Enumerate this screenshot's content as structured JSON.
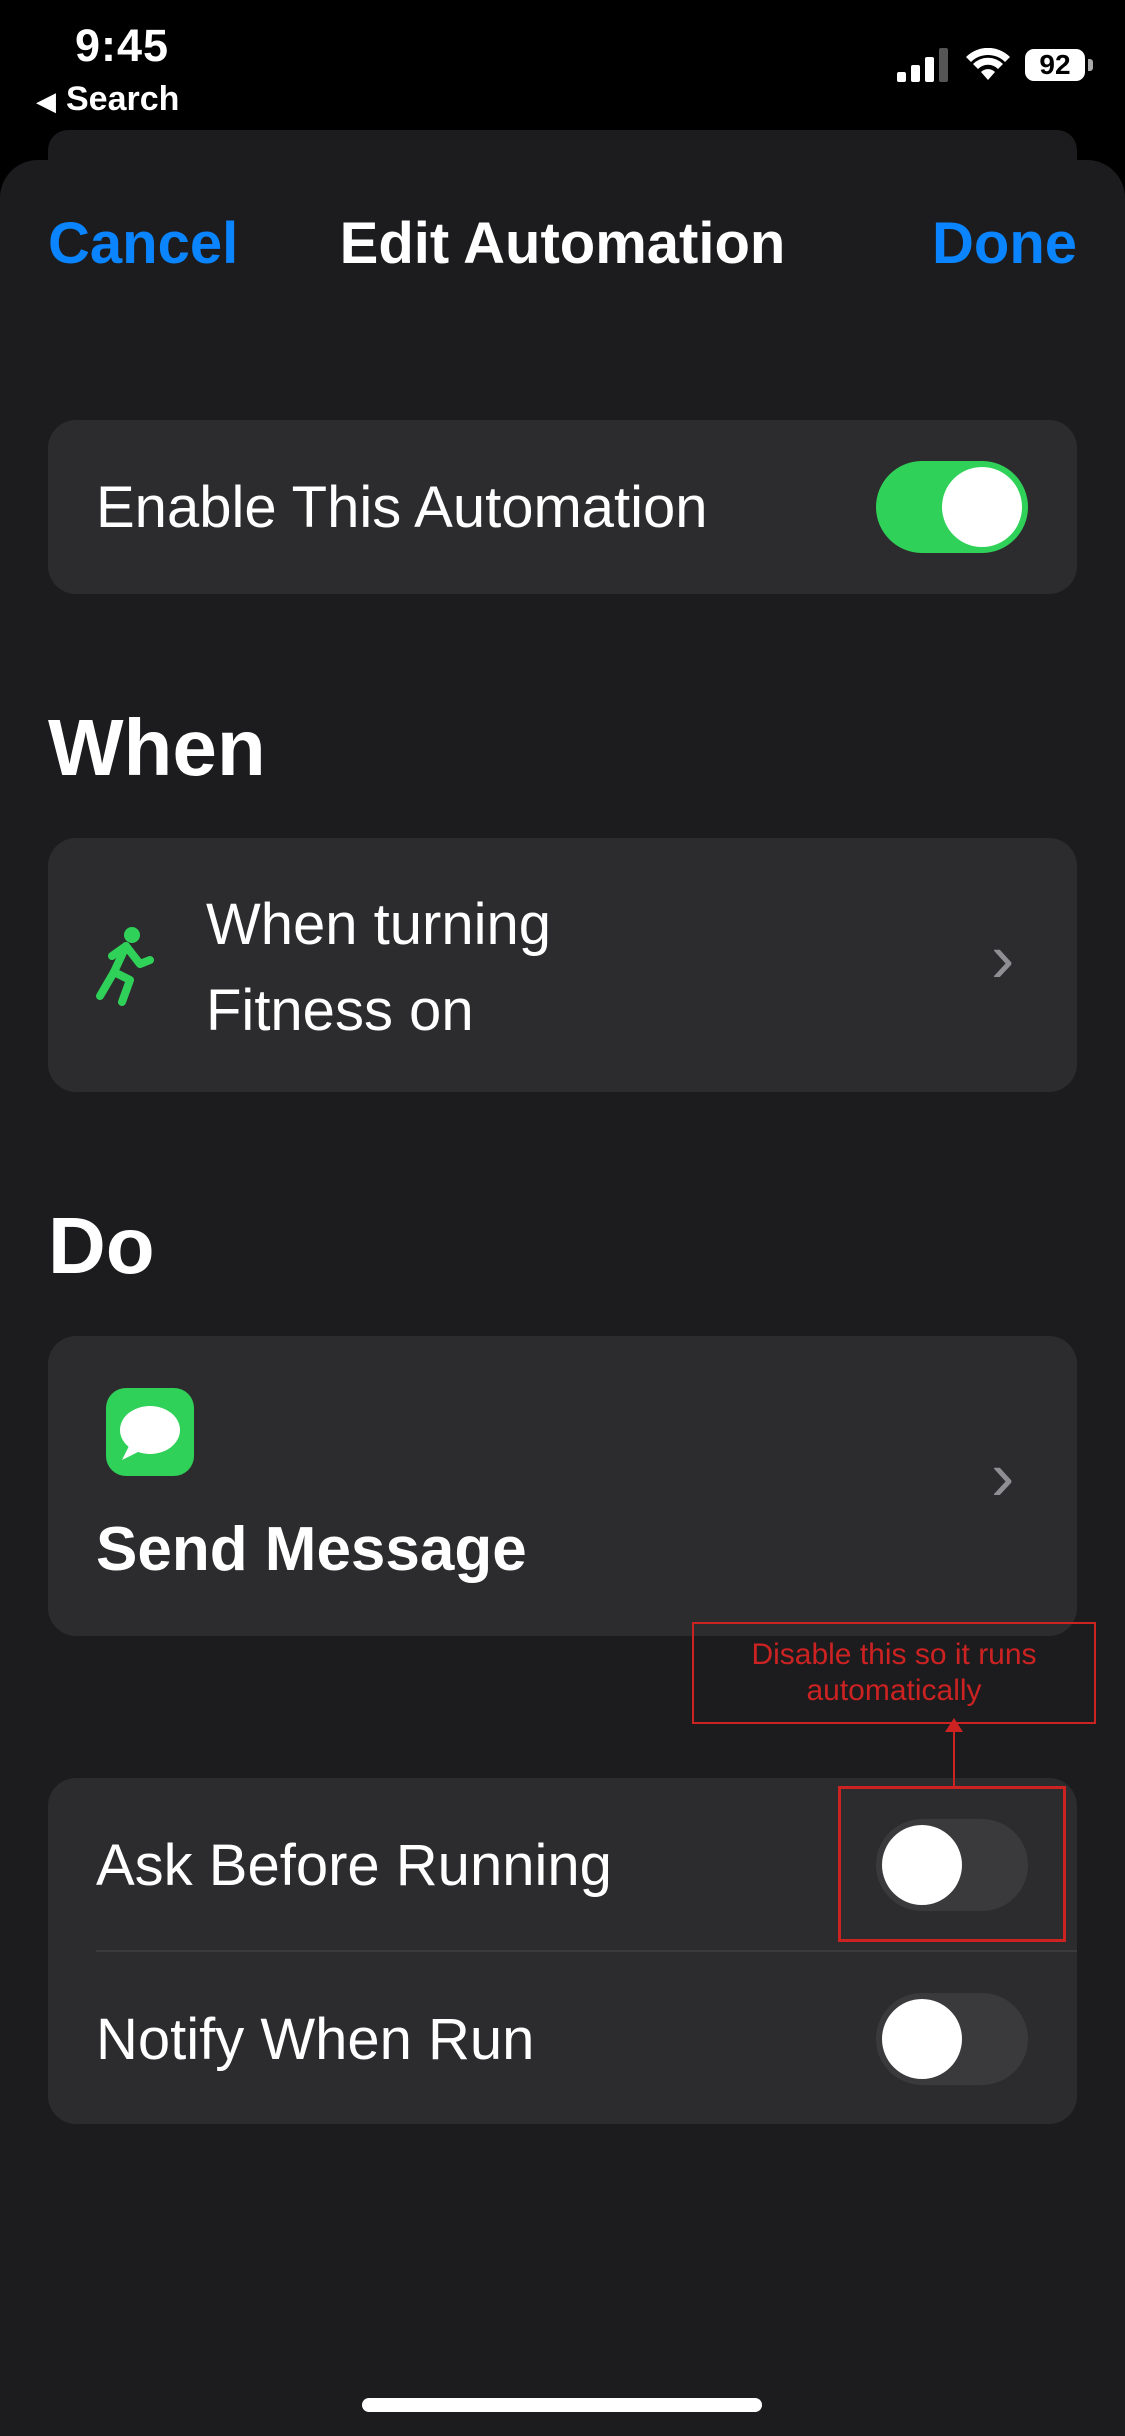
{
  "status_bar": {
    "time": "9:45",
    "back_label": "Search",
    "battery": "92"
  },
  "nav": {
    "cancel": "Cancel",
    "title": "Edit Automation",
    "done": "Done"
  },
  "enable": {
    "label": "Enable This Automation",
    "on": true
  },
  "when": {
    "header": "When",
    "trigger_line1": "When turning",
    "trigger_line2": "Fitness on",
    "icon": "running-figure-icon"
  },
  "do": {
    "header": "Do",
    "action": "Send Message",
    "icon": "messages-app-icon"
  },
  "options": [
    {
      "label": "Ask Before Running",
      "on": false
    },
    {
      "label": "Notify When Run",
      "on": false
    }
  ],
  "annotation": {
    "line1": "Disable this so it runs",
    "line2": "automatically"
  },
  "colors": {
    "accent": "#0a84ff",
    "toggle_on": "#30d158",
    "annotation": "#cc2222",
    "fitness": "#30d158"
  }
}
